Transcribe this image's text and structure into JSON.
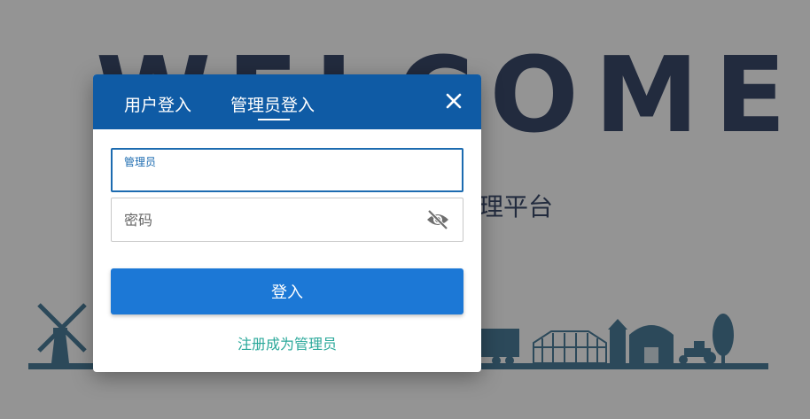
{
  "background": {
    "welcome_text": "WELCOME",
    "subtitle_text": "理平台",
    "scene_color": "#4d7f9c"
  },
  "dialog": {
    "tabs": [
      {
        "label": "用户登入",
        "active": false
      },
      {
        "label": "管理员登入",
        "active": true
      }
    ],
    "close_icon": "close-icon",
    "username_field": {
      "label": "管理员",
      "value": ""
    },
    "password_field": {
      "placeholder": "密码",
      "value": "",
      "toggle_icon": "eye-slash-icon"
    },
    "login_button": "登入",
    "register_link": "注册成为管理员",
    "colors": {
      "header": "#0f5ba5",
      "button": "#1c78d6",
      "link": "#2aa89a",
      "focus": "#1c6bb0"
    }
  }
}
